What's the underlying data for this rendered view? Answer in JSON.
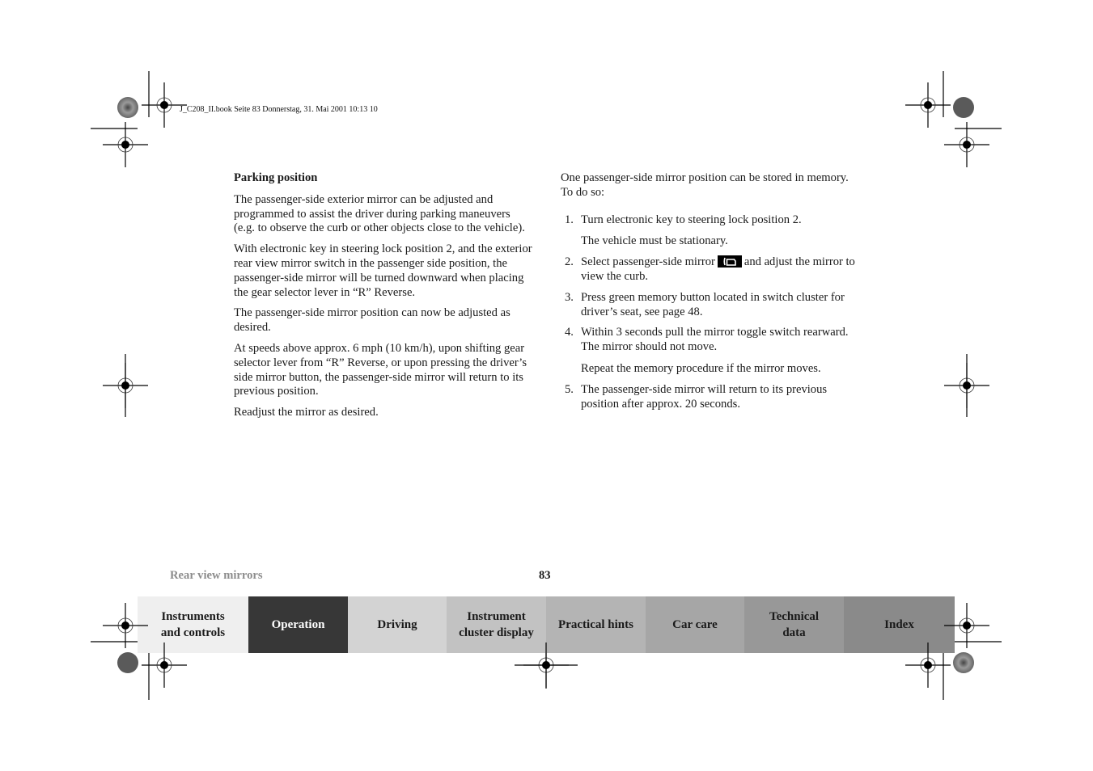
{
  "print_header": "J_C208_II.book  Seite 83  Donnerstag, 31. Mai 2001  10:13 10",
  "left_column": {
    "heading": "Parking position",
    "paragraphs": [
      "The passenger-side exterior mirror can be adjusted and programmed to assist the driver during parking maneuvers (e.g. to observe the curb or other objects close to the vehicle).",
      "With electronic key in steering lock position 2, and the exterior rear view mirror switch in the passenger side position, the passenger-side mirror will be turned downward when placing the gear selector lever in “R” Reverse.",
      "The passenger-side mirror position can now be adjusted as desired.",
      "At speeds above approx. 6 mph (10 km/h), upon shifting gear selector lever from “R” Reverse, or upon pressing the driver’s side mirror button, the passenger-side mirror will return to its previous position.",
      "Readjust the mirror as desired."
    ]
  },
  "right_column": {
    "intro": "One passenger-side mirror position can be stored in memory. To do so:",
    "steps": [
      {
        "num": "1.",
        "text": "Turn electronic key to steering lock position 2.",
        "note": "The vehicle must be stationary."
      },
      {
        "num": "2.",
        "text_before": "Select passenger-side mirror",
        "icon": "passenger-mirror-button-icon",
        "text_after": "and adjust the mirror to view the curb."
      },
      {
        "num": "3.",
        "text": "Press green memory button located in switch cluster for driver’s seat, see page 48."
      },
      {
        "num": "4.",
        "text": "Within 3 seconds pull the mirror toggle switch rearward. The mirror should not move.",
        "note": "Repeat the memory procedure if the mirror moves."
      },
      {
        "num": "5.",
        "text": "The passenger-side mirror will return to its previous position after approx. 20 seconds."
      }
    ]
  },
  "footer": {
    "section": "Rear view mirrors",
    "page_number": "83"
  },
  "tabs": [
    {
      "line1": "Instruments",
      "line2": "and controls",
      "bg": "#efefef",
      "fg": "#1a1a1a"
    },
    {
      "line1": "Operation",
      "line2": "",
      "bg": "#373737",
      "fg": "#ffffff",
      "active": true
    },
    {
      "line1": "Driving",
      "line2": "",
      "bg": "#d3d3d3",
      "fg": "#1a1a1a"
    },
    {
      "line1": "Instrument",
      "line2": "cluster display",
      "bg": "#c2c2c2",
      "fg": "#1a1a1a"
    },
    {
      "line1": "Practical hints",
      "line2": "",
      "bg": "#b4b4b4",
      "fg": "#1a1a1a"
    },
    {
      "line1": "Car care",
      "line2": "",
      "bg": "#a6a6a6",
      "fg": "#1a1a1a"
    },
    {
      "line1": "Technical",
      "line2": "data",
      "bg": "#989898",
      "fg": "#1a1a1a"
    },
    {
      "line1": "Index",
      "line2": "",
      "bg": "#8a8a8a",
      "fg": "#1a1a1a"
    }
  ]
}
